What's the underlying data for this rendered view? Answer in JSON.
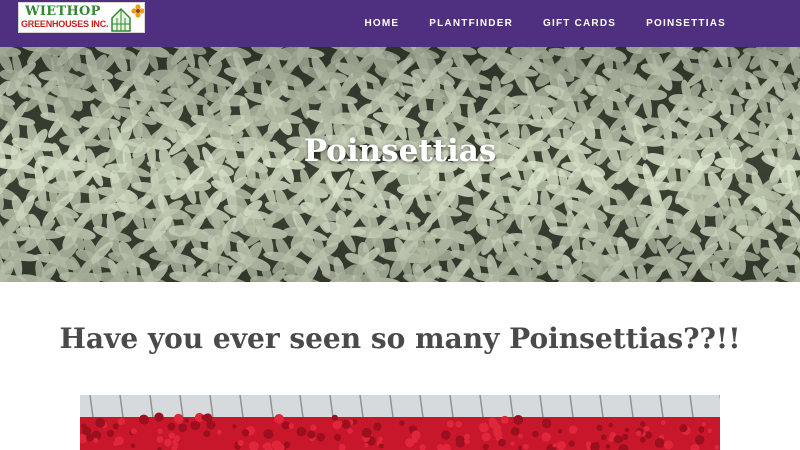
{
  "brand": {
    "name_line1": "WIETHOP",
    "name_line2": "GREENHOUSES INC."
  },
  "nav": {
    "items": [
      {
        "label": "HOME"
      },
      {
        "label": "PLANTFINDER"
      },
      {
        "label": "GIFT CARDS"
      },
      {
        "label": "POINSETTIAS"
      }
    ]
  },
  "hero": {
    "title": "Poinsettias"
  },
  "main": {
    "heading": "Have you ever seen so many Poinsettias??!!"
  },
  "colors": {
    "nav_background": "#4f2f7f",
    "logo_green": "#2f8a2f",
    "logo_red": "#c62020",
    "heading_text": "#4a4a4a"
  }
}
